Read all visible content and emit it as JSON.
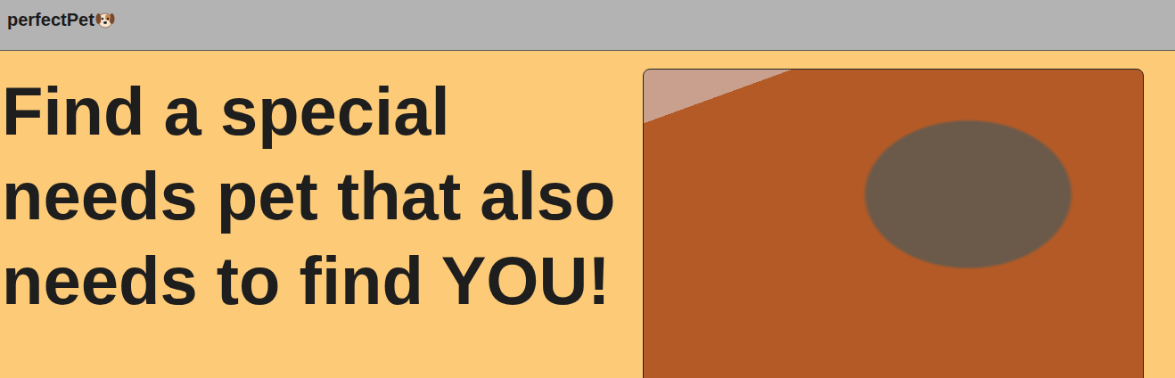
{
  "header": {
    "logo": "perfectPet"
  },
  "hero": {
    "heading": "Find a special needs pet that also needs to find YOU!"
  }
}
